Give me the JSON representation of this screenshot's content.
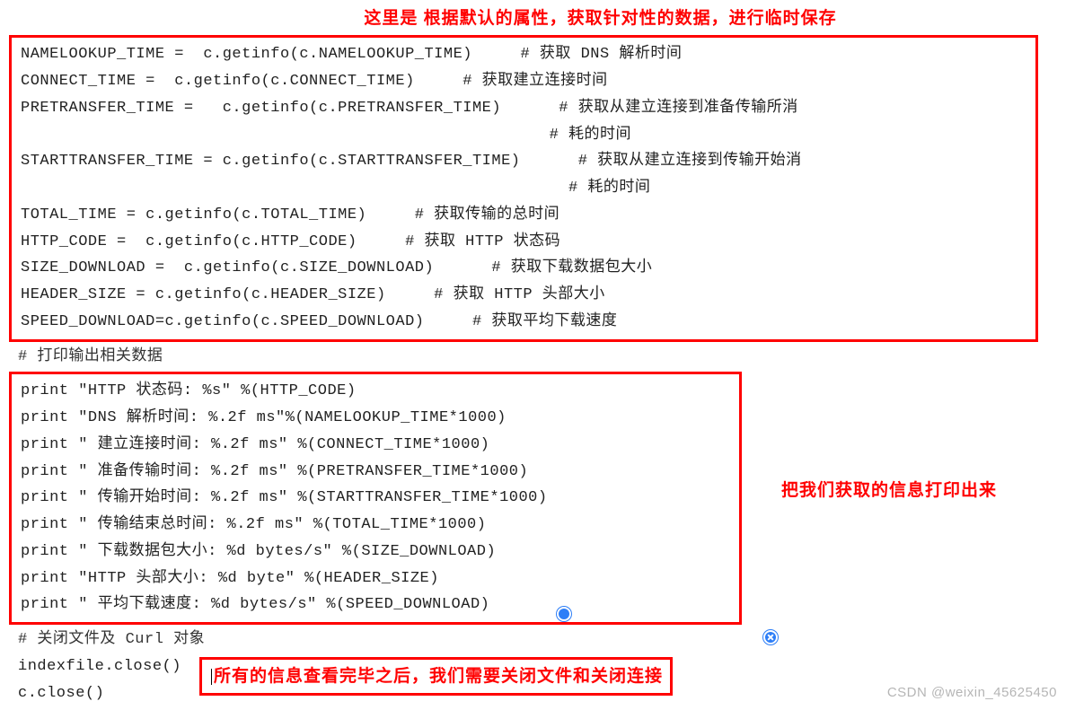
{
  "title_top": "这里是 根据默认的属性，获取针对性的数据，进行临时保存",
  "block1": {
    "l1": "NAMELOOKUP_TIME =  c.getinfo(c.NAMELOOKUP_TIME)     # 获取 DNS 解析时间",
    "l2": "CONNECT_TIME =  c.getinfo(c.CONNECT_TIME)     # 获取建立连接时间",
    "l3": "PRETRANSFER_TIME =   c.getinfo(c.PRETRANSFER_TIME)      # 获取从建立连接到准备传输所消",
    "l3b": "                                                       # 耗的时间",
    "l4": "STARTTRANSFER_TIME = c.getinfo(c.STARTTRANSFER_TIME)      # 获取从建立连接到传输开始消",
    "l4b": "                                                         # 耗的时间",
    "l5": "TOTAL_TIME = c.getinfo(c.TOTAL_TIME)     # 获取传输的总时间",
    "l6": "HTTP_CODE =  c.getinfo(c.HTTP_CODE)     # 获取 HTTP 状态码",
    "l7": "SIZE_DOWNLOAD =  c.getinfo(c.SIZE_DOWNLOAD)      # 获取下载数据包大小",
    "l8": "HEADER_SIZE = c.getinfo(c.HEADER_SIZE)     # 获取 HTTP 头部大小",
    "l9": "SPEED_DOWNLOAD=c.getinfo(c.SPEED_DOWNLOAD)     # 获取平均下载速度"
  },
  "comment_mid": "# 打印输出相关数据",
  "block2": {
    "p1": "print \"HTTP 状态码: %s\" %(HTTP_CODE)",
    "p2": "print \"DNS 解析时间: %.2f ms\"%(NAMELOOKUP_TIME*1000)",
    "p3": "print \" 建立连接时间: %.2f ms\" %(CONNECT_TIME*1000)",
    "p4": "print \" 准备传输时间: %.2f ms\" %(PRETRANSFER_TIME*1000)",
    "p5": "print \" 传输开始时间: %.2f ms\" %(STARTTRANSFER_TIME*1000)",
    "p6": "print \" 传输结束总时间: %.2f ms\" %(TOTAL_TIME*1000)",
    "p7": "print \" 下载数据包大小: %d bytes/s\" %(SIZE_DOWNLOAD)",
    "p8": "print \"HTTP 头部大小: %d byte\" %(HEADER_SIZE)",
    "p9": "print \" 平均下载速度: %d bytes/s\" %(SPEED_DOWNLOAD)"
  },
  "note_right": "把我们获取的信息打印出来",
  "comment_close": "# 关闭文件及 Curl 对象",
  "tail": {
    "t1": "indexfile.close()",
    "t2": "c.close()"
  },
  "caption_bottom": "所有的信息查看完毕之后，我们需要关闭文件和关闭连接",
  "watermark": "CSDN @weixin_45625450"
}
